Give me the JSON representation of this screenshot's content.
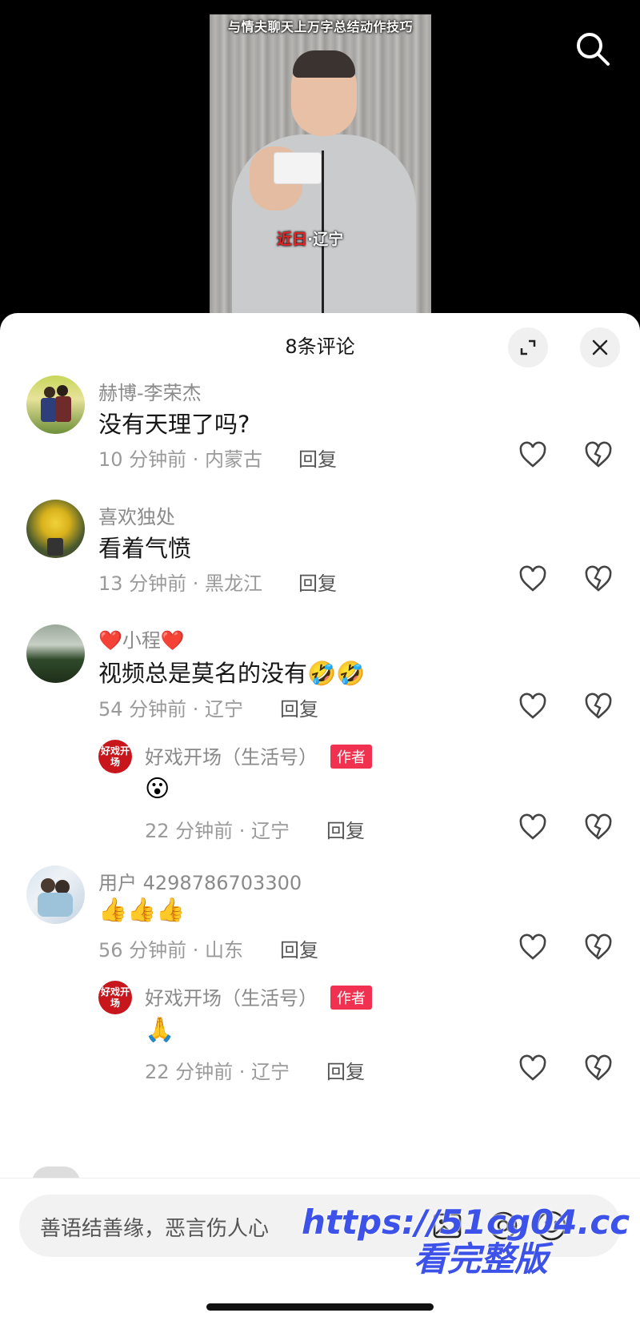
{
  "video": {
    "title_overlay": "与情夫聊天上万字总结动作技巧",
    "location_red": "近日",
    "location_rest": "·辽宁"
  },
  "sheet": {
    "title": "8条评论"
  },
  "comments": [
    {
      "user": "赫博-李荣杰",
      "text": "没有天理了吗?",
      "time": "10 分钟前 · 内蒙古",
      "reply": "回复"
    },
    {
      "user": "喜欢独处",
      "text": "看着气愤",
      "time": "13 分钟前 · 黑龙江",
      "reply": "回复"
    },
    {
      "user_prefix": "❤️",
      "user": "小程",
      "user_suffix": "❤️",
      "text": "视频总是莫名的没有",
      "text_emoji": "🤣🤣",
      "time": "54 分钟前 · 辽宁",
      "reply": "回复",
      "sub_reply": {
        "avatar_text": "好戏开场",
        "user": "好戏开场（生活号）",
        "badge": "作者",
        "text": "😮",
        "time": "22 分钟前 · 辽宁",
        "reply": "回复"
      }
    },
    {
      "user": "用户 4298786703300",
      "text": "👍👍👍",
      "time": "56 分钟前 · 山东",
      "reply": "回复",
      "sub_reply": {
        "avatar_text": "好戏开场",
        "user": "好戏开场（生活号）",
        "badge": "作者",
        "text": "🙏",
        "time": "22 分钟前 · 辽宁",
        "reply": "回复"
      }
    }
  ],
  "input": {
    "placeholder": "善语结善缘，恶言伤人心"
  },
  "watermark": {
    "line1": "https://51cg04.cc",
    "line2": "看完整版"
  },
  "icons": {
    "search": "search-icon",
    "expand": "expand-icon",
    "close": "close-icon",
    "like": "heart-icon",
    "dislike": "broken-heart-icon",
    "image": "image-icon",
    "mention": "at-icon",
    "emoji": "emoji-icon"
  }
}
